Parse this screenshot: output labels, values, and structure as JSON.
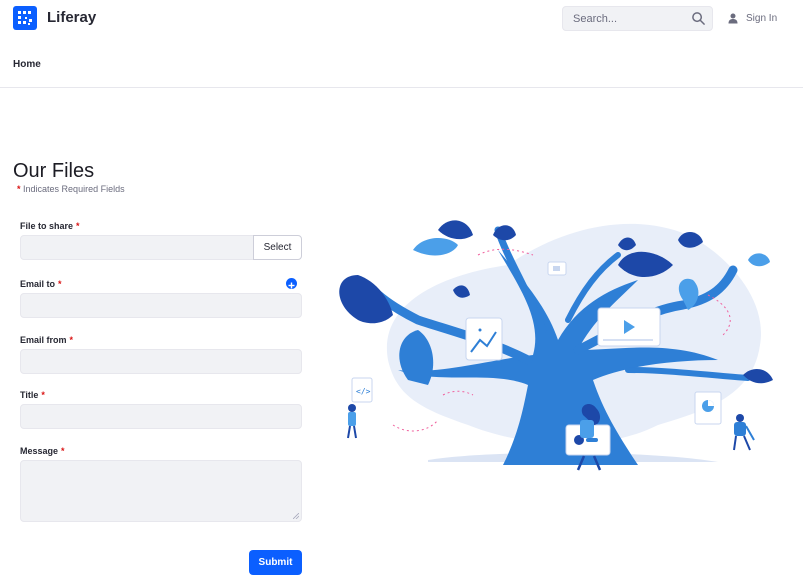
{
  "header": {
    "site_name": "Liferay",
    "search_placeholder": "Search...",
    "signin_label": "Sign In",
    "logo_icon": "liferay-logo",
    "search_icon": "search-icon",
    "user_icon": "user-icon"
  },
  "nav": {
    "home_label": "Home"
  },
  "form": {
    "title": "Our Files",
    "required_asterisk": "*",
    "required_note": "Indicates Required Fields",
    "fields": {
      "file_to_share": {
        "label": "File to share",
        "value": "",
        "select_label": "Select"
      },
      "email_to": {
        "label": "Email to",
        "value": ""
      },
      "email_from": {
        "label": "Email from",
        "value": ""
      },
      "title": {
        "label": "Title",
        "value": ""
      },
      "message": {
        "label": "Message",
        "value": ""
      }
    },
    "submit_label": "Submit"
  },
  "colors": {
    "primary": "#0b5fff",
    "field_bg": "#f1f2f5",
    "required": "#da1414",
    "illustration_blue": "#2e7fd6",
    "illustration_navy": "#1d48a8",
    "illustration_light": "#e8eef9"
  }
}
